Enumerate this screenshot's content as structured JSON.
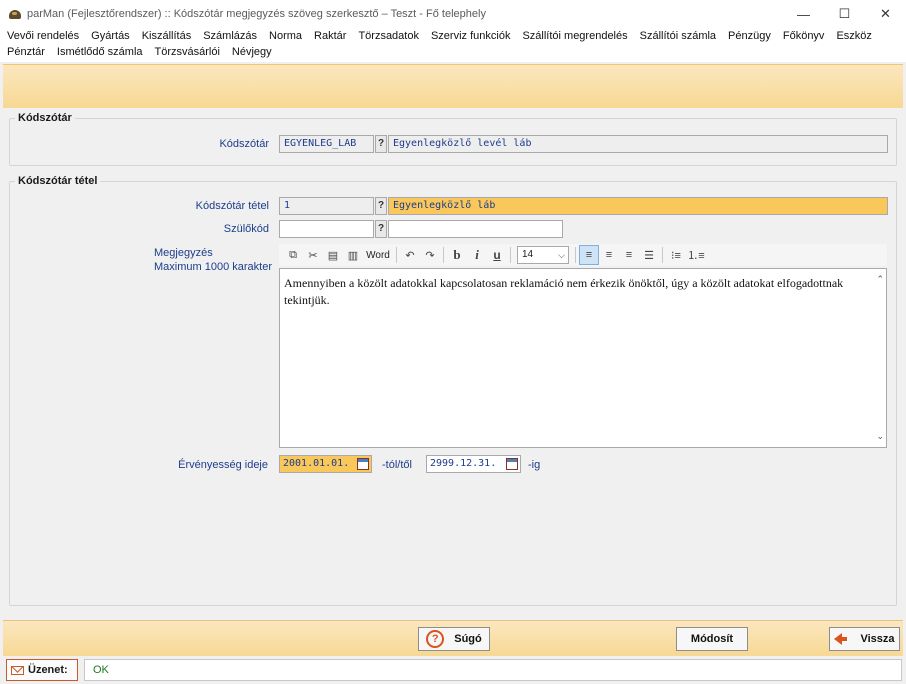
{
  "window": {
    "title": "parMan (Fejlesztőrendszer) :: Kódszótár megjegyzés szöveg szerkesztő  –  Teszt - Fő telephely",
    "minimize": "—",
    "maximize": "☐",
    "close": "✕"
  },
  "menu": [
    "Vevői rendelés",
    "Gyártás",
    "Kiszállítás",
    "Számlázás",
    "Norma",
    "Raktár",
    "Törzsadatok",
    "Szerviz funkciók",
    "Szállítói megrendelés",
    "Szállítói számla",
    "Pénzügy",
    "Főkönyv",
    "Eszköz",
    "Pénztár",
    "Ismétlődő számla",
    "Törzsvásárlói",
    "Névjegy"
  ],
  "kodszotar_group": {
    "title": "Kódszótár",
    "label": "Kódszótár",
    "code": "EGYENLEG_LAB",
    "q": "?",
    "name": "Egyenlegközlő levél láb"
  },
  "tetel_group": {
    "title": "Kódszótár tétel",
    "tetel_label": "Kódszótár tétel",
    "tetel_code": "1",
    "tetel_q": "?",
    "tetel_name": "Egyenlegközlő láb",
    "szulo_label": "Szülőkód",
    "szulo_code": "",
    "szulo_q": "?",
    "szulo_name": "",
    "megj_label": "Megjegyzés",
    "megj_max": "Maximum 1000 karakter",
    "toolbar": {
      "word": "Word",
      "bold": "b",
      "italic": "i",
      "underline": "u",
      "font_size": "14"
    },
    "text": "Amennyiben a közölt adatokkal kapcsolatosan reklamáció nem érkezik önöktől, úgy a közölt adatokat elfogadottnak tekintjük.",
    "ervenyes_label": "Érvényesség ideje",
    "date_from": "2001.01.01.",
    "tol": "-tól/től",
    "date_to": "2999.12.31.",
    "ig": "-ig"
  },
  "buttons": {
    "help": "Súgó",
    "modify": "Módosít",
    "back": "Vissza"
  },
  "status": {
    "label": "Üzenet:",
    "message": "OK"
  },
  "colors": {
    "banner": "#f7d894",
    "highlight_field": "#f9c75a",
    "label_blue": "#1c3d8c",
    "accent_orange": "#d9541e"
  }
}
